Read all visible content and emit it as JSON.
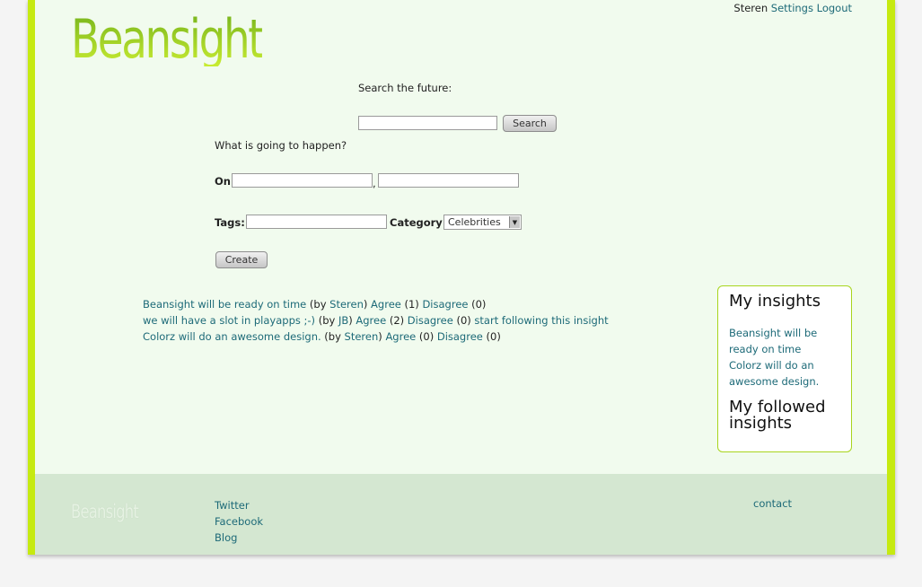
{
  "brand": {
    "logo_text": "Beansight",
    "footer_logo_text": "Beansight"
  },
  "userbar": {
    "username": "Steren",
    "settings": "Settings",
    "logout": "Logout"
  },
  "search": {
    "label": "Search the future:",
    "value": "",
    "button": "Search"
  },
  "create_form": {
    "question": "What is going to happen?",
    "on_label": "On",
    "on_value1": "",
    "separator": ",",
    "on_value2": "",
    "tags_label": "Tags:",
    "tags_value": "",
    "category_label": "Category:",
    "category_selected": "Celebrities",
    "create_button": "Create"
  },
  "insights": [
    {
      "title": "Beansight will be ready on time",
      "by_prefix": " (by ",
      "author": "Steren",
      "by_suffix": ") ",
      "agree": "Agree",
      "agree_count": " (1) ",
      "disagree": "Disagree",
      "disagree_count": " (0)",
      "follow": ""
    },
    {
      "title": "we will have a slot in playapps ;-)",
      "by_prefix": " (by ",
      "author": "JB",
      "by_suffix": ") ",
      "agree": "Agree",
      "agree_count": " (2) ",
      "disagree": "Disagree",
      "disagree_count": " (0) ",
      "follow": "start following this insight"
    },
    {
      "title": "Colorz will do an awesome design.",
      "by_prefix": " (by ",
      "author": "Steren",
      "by_suffix": ") ",
      "agree": "Agree",
      "agree_count": " (0) ",
      "disagree": "Disagree",
      "disagree_count": " (0)",
      "follow": ""
    }
  ],
  "sidebar": {
    "my_insights_title": "My insights",
    "my_insights": [
      "Beansight will be ready on time",
      "Colorz will do an awesome design."
    ],
    "followed_title": "My followed insights"
  },
  "footer": {
    "links": [
      "Twitter",
      "Facebook",
      "Blog"
    ],
    "contact": "contact"
  },
  "colors": {
    "accent": "#c6ea10",
    "background": "#f1fbee",
    "footer": "#d4e7d1",
    "link": "#1d6a78"
  }
}
